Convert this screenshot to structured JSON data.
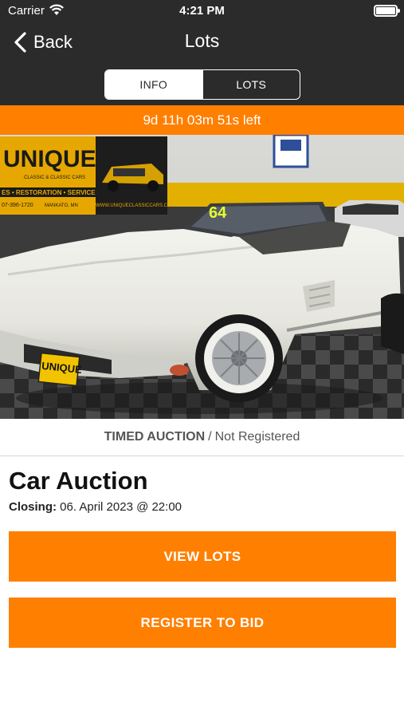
{
  "status_bar": {
    "carrier": "Carrier",
    "time": "4:21 PM",
    "icons": [
      "wifi-icon",
      "battery-icon"
    ]
  },
  "nav": {
    "back_label": "Back",
    "title": "Lots"
  },
  "segment": {
    "tabs": [
      {
        "label": "INFO",
        "selected": true
      },
      {
        "label": "LOTS",
        "selected": false
      }
    ]
  },
  "timer": {
    "text": "9d 11h 03m 51s left"
  },
  "photo": {
    "banner_brand": "UNIQUE",
    "banner_subtitle": "CLASSIC & CLASSIC CARS",
    "banner_services": "ES • RESTORATION • SERVICE",
    "banner_phone": "07-396-1720",
    "banner_city": "MANKATO, MN",
    "banner_url": "WWW.UNIQUECLASSICCARS.COM",
    "windshield_number": "64",
    "plate_text": "UNIQUE"
  },
  "auction": {
    "type": "TIMED AUCTION",
    "separator": "/",
    "registration": "Not Registered",
    "title": "Car Auction",
    "closing_label": "Closing:",
    "closing_value": "06. April 2023 @ 22:00"
  },
  "buttons": {
    "view_lots": "VIEW LOTS",
    "register": "REGISTER TO BID"
  },
  "colors": {
    "accent": "#ff7f00",
    "header_bg": "#2b2b2b"
  }
}
